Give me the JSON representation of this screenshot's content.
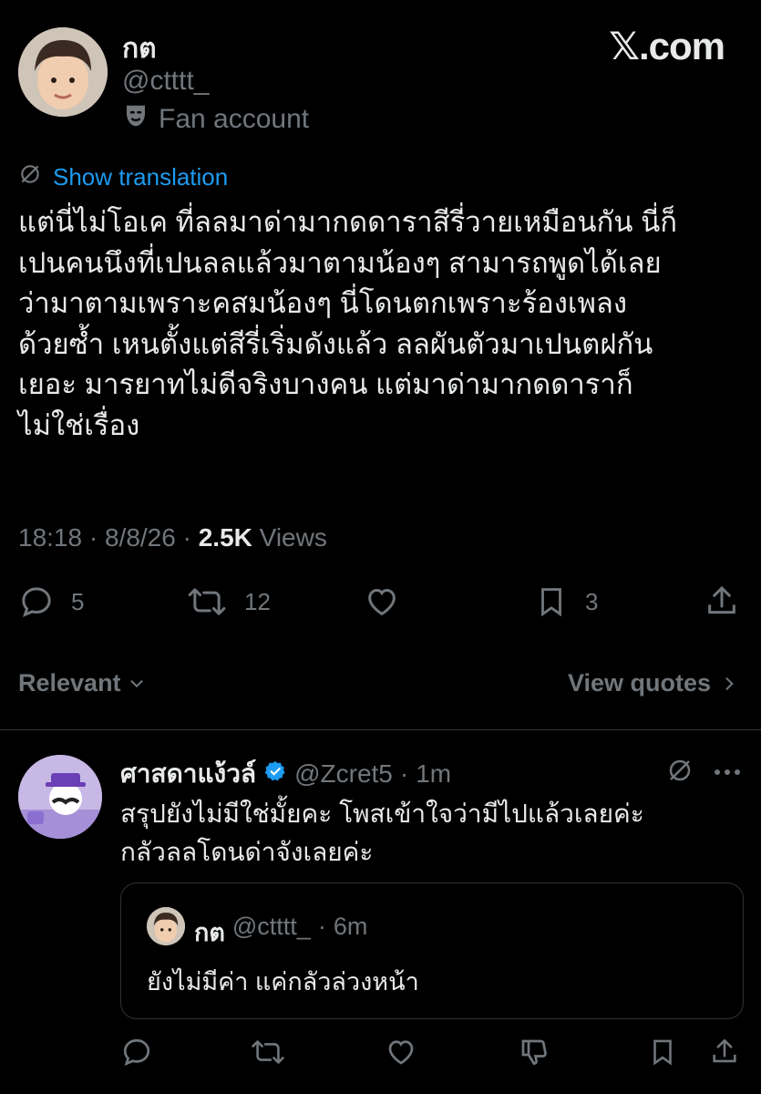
{
  "brand": {
    "site": "𝕏.com"
  },
  "post": {
    "author_name": "กต",
    "author_handle": "@ctttt_",
    "author_label": "Fan account",
    "translate_label": "Show translation",
    "text": "แต่นี่ไม่โอเค ที่ลลมาด่ามากดดาราสีรี่วายเหมือนกัน นี่ก็\nเปนคนนึงที่เปนลลแล้วมาตามน้องๆ สามารถพูดได้เลย\nว่ามาตามเพราะคสมน้องๆ นี่โดนตกเพราะร้องเพลง\nด้วยซ้ำ เหนตั้งแต่สีรี่เริ่มดังแล้ว ลลผันตัวมาเปนตฝกัน\nเยอะ มารยาทไม่ดีจริงบางคน แต่มาด่ามากดดาราก็\nไม่ใช่เรื่อง",
    "time": "18:18",
    "date": "8/8/26",
    "views_count": "2.5K",
    "views_label": "Views",
    "replies": "5",
    "reposts": "12",
    "bookmarks": "3"
  },
  "filter": {
    "sort_label": "Relevant",
    "quotes_label": "View quotes"
  },
  "reply": {
    "author_name": "ศาสดาแง้วล์",
    "author_handle": "@Zcret5",
    "age": "1m",
    "text": "สรุปยังไม่มีใช่มั้ยคะ โพสเข้าใจว่ามีไปแล้วเลยค่ะ\nกลัวลลโดนด่าจังเลยค่ะ",
    "quote": {
      "author_name": "กต",
      "author_handle": "@ctttt_",
      "age": "6m",
      "text": "ยังไม่มีค่า แค่กลัวล่วงหน้า"
    }
  },
  "colors": {
    "accent": "#1d9bf0",
    "muted": "#71767b",
    "text": "#e7e9ea",
    "verified": "#1d9bf0"
  }
}
